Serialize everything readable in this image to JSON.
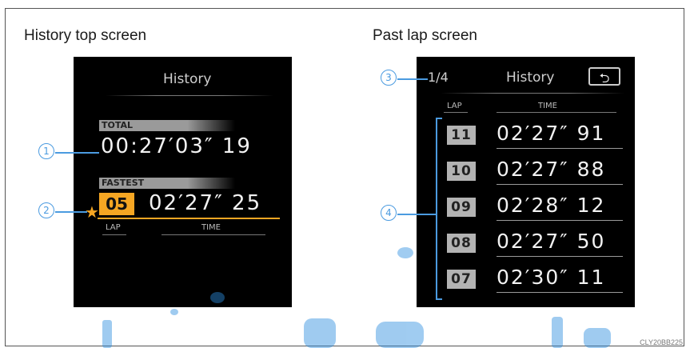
{
  "left_panel": {
    "caption": "History top screen",
    "title": "History",
    "total_label": "TOTAL",
    "total_time": "00:27′03″ 19",
    "fastest_label": "FASTEST",
    "fastest_lap": "05",
    "fastest_time": "02′27″ 25",
    "col_lap": "LAP",
    "col_time": "TIME",
    "callouts": [
      "1",
      "2"
    ],
    "star": "★"
  },
  "right_panel": {
    "caption": "Past lap screen",
    "page": "1/4",
    "title": "History",
    "back_icon": "⮌",
    "col_lap": "LAP",
    "col_time": "TIME",
    "callouts": [
      "3",
      "4"
    ],
    "laps": [
      {
        "lap": "11",
        "time": "02′27″ 91"
      },
      {
        "lap": "10",
        "time": "02′27″ 88"
      },
      {
        "lap": "09",
        "time": "02′28″ 12"
      },
      {
        "lap": "08",
        "time": "02′27″ 50"
      },
      {
        "lap": "07",
        "time": "02′30″ 11"
      }
    ]
  },
  "figure_code": "CLY20BB225",
  "colors": {
    "accent_orange": "#f5a623",
    "callout_blue": "#4b9be0",
    "screen_bg": "#000000"
  }
}
